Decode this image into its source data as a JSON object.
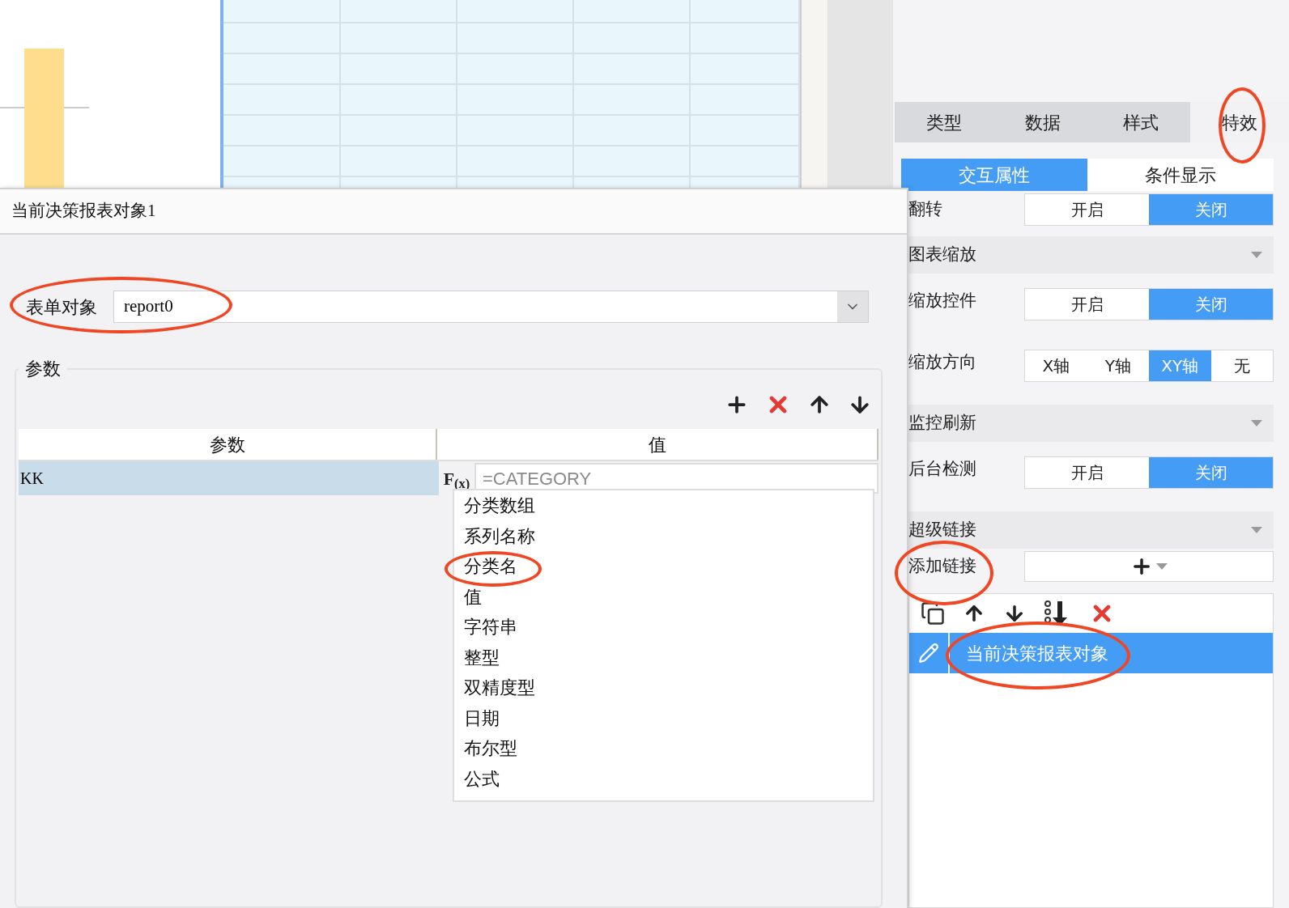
{
  "right_panel": {
    "tabs": [
      {
        "label": "类型",
        "selected": false
      },
      {
        "label": "数据",
        "selected": false
      },
      {
        "label": "样式",
        "selected": false
      },
      {
        "label": "特效",
        "selected": true
      }
    ],
    "subtabs": [
      {
        "label": "交互属性",
        "selected": true
      },
      {
        "label": "条件显示",
        "selected": false
      }
    ],
    "rows": [
      {
        "kind": "toggle",
        "label": "翻转",
        "options": [
          {
            "label": "开启",
            "selected": false
          },
          {
            "label": "关闭",
            "selected": true
          }
        ]
      },
      {
        "kind": "section",
        "label": "图表缩放"
      },
      {
        "kind": "toggle",
        "label": "缩放控件",
        "options": [
          {
            "label": "开启",
            "selected": false
          },
          {
            "label": "关闭",
            "selected": true
          }
        ]
      },
      {
        "kind": "toggle",
        "label": "缩放方向",
        "options": [
          {
            "label": "X轴",
            "selected": false
          },
          {
            "label": "Y轴",
            "selected": false
          },
          {
            "label": "XY轴",
            "selected": true
          },
          {
            "label": "无",
            "selected": false
          }
        ]
      },
      {
        "kind": "section",
        "label": "监控刷新"
      },
      {
        "kind": "toggle",
        "label": "后台检测",
        "options": [
          {
            "label": "开启",
            "selected": false
          },
          {
            "label": "关闭",
            "selected": true
          }
        ]
      },
      {
        "kind": "section",
        "label": "超级链接"
      },
      {
        "kind": "add",
        "label": "添加链接"
      }
    ],
    "links": [
      {
        "label": "当前决策报表对象",
        "selected": true
      }
    ]
  },
  "dialog": {
    "title": "当前决策报表对象1",
    "form_object": {
      "label": "表单对象",
      "value": "report0"
    },
    "params": {
      "legend": "参数",
      "columns": [
        "参数",
        "值"
      ],
      "rows": [
        {
          "name": "KK",
          "formula_button": "F$_{(x)}$",
          "value": "=CATEGORY",
          "selected": true
        }
      ],
      "menu": [
        "分类数组",
        "系列名称",
        "分类名",
        "值",
        "字符串",
        "整型",
        "双精度型",
        "日期",
        "布尔型",
        "公式"
      ]
    }
  }
}
